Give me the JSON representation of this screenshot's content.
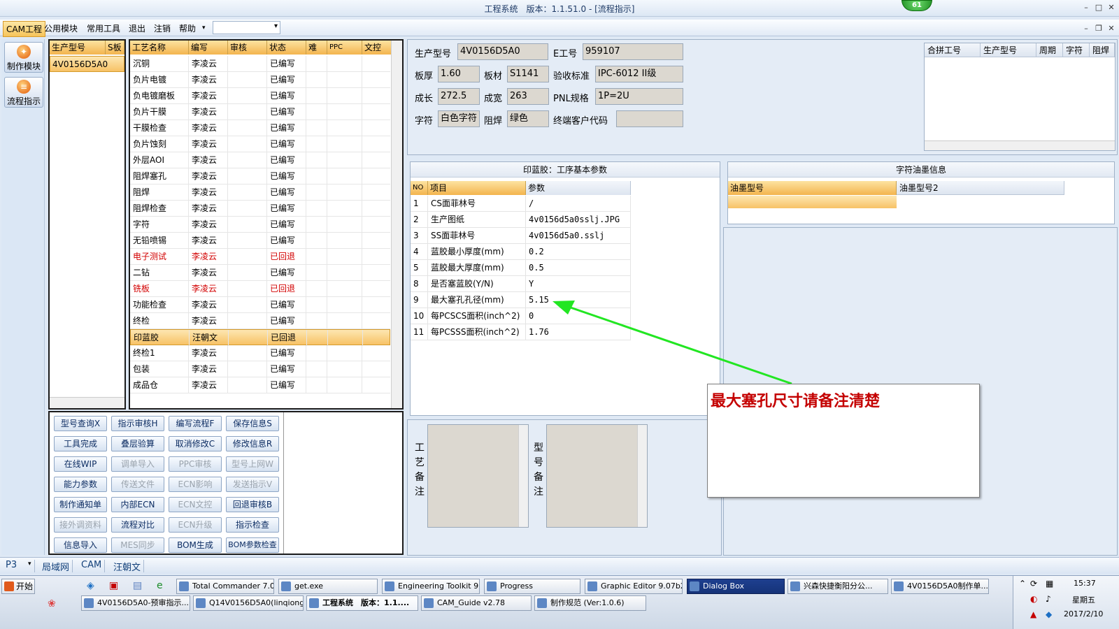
{
  "window": {
    "title": "工程系统　版本：1.1.51.0 - [流程指示]",
    "badge": "61",
    "min": "–",
    "max": "□",
    "close": "✕",
    "child_min": "–",
    "child_max": "❐",
    "child_close": "✕"
  },
  "menu": {
    "cam": "CAM工程",
    "items": [
      "公用模块",
      "常用工具",
      "退出",
      "注销",
      "帮助"
    ],
    "help_arrow": "▾"
  },
  "side": {
    "buttons": [
      "制作模块",
      "流程指示"
    ]
  },
  "model_list": {
    "headers": [
      "生产型号",
      "S板"
    ],
    "items": [
      "4V0156D5A0"
    ]
  },
  "process": {
    "headers": [
      "工艺名称",
      "编写",
      "审核",
      "状态",
      "难",
      "PPC",
      "文控"
    ],
    "rows": [
      {
        "name": "沉铜",
        "writer": "李凌云",
        "status": "已编写",
        "red": false
      },
      {
        "name": "负片电镀",
        "writer": "李凌云",
        "status": "已编写",
        "red": false
      },
      {
        "name": "负电镀磨板",
        "writer": "李凌云",
        "status": "已编写",
        "red": false
      },
      {
        "name": "负片干膜",
        "writer": "李凌云",
        "status": "已编写",
        "red": false
      },
      {
        "name": "干膜检查",
        "writer": "李凌云",
        "status": "已编写",
        "red": false
      },
      {
        "name": "负片蚀刻",
        "writer": "李凌云",
        "status": "已编写",
        "red": false
      },
      {
        "name": "外层AOI",
        "writer": "李凌云",
        "status": "已编写",
        "red": false
      },
      {
        "name": "阻焊塞孔",
        "writer": "李凌云",
        "status": "已编写",
        "red": false
      },
      {
        "name": "阻焊",
        "writer": "李凌云",
        "status": "已编写",
        "red": false
      },
      {
        "name": "阻焊检查",
        "writer": "李凌云",
        "status": "已编写",
        "red": false
      },
      {
        "name": "字符",
        "writer": "李凌云",
        "status": "已编写",
        "red": false
      },
      {
        "name": "无铅喷锡",
        "writer": "李凌云",
        "status": "已编写",
        "red": false
      },
      {
        "name": "电子测试",
        "writer": "李凌云",
        "status": "已回退",
        "red": true
      },
      {
        "name": "二钻",
        "writer": "李凌云",
        "status": "已编写",
        "red": false
      },
      {
        "name": "铣板",
        "writer": "李凌云",
        "status": "已回退",
        "red": true
      },
      {
        "name": "功能检查",
        "writer": "李凌云",
        "status": "已编写",
        "red": false
      },
      {
        "name": "终检",
        "writer": "李凌云",
        "status": "已编写",
        "red": false
      },
      {
        "name": "印蓝胶",
        "writer": "汪朝文",
        "status": "已回退",
        "red": false,
        "selected": true
      },
      {
        "name": "终检1",
        "writer": "李凌云",
        "status": "已编写",
        "red": false
      },
      {
        "name": "包装",
        "writer": "李凌云",
        "status": "已编写",
        "red": false
      },
      {
        "name": "成品仓",
        "writer": "李凌云",
        "status": "已编写",
        "red": false
      }
    ]
  },
  "buttons": [
    [
      {
        "label": "型号查询X",
        "enabled": true
      },
      {
        "label": "指示审核H",
        "enabled": true
      },
      {
        "label": "编写流程F",
        "enabled": true
      },
      {
        "label": "保存信息S",
        "enabled": true
      }
    ],
    [
      {
        "label": "工具完成",
        "enabled": true
      },
      {
        "label": "叠层验算",
        "enabled": true
      },
      {
        "label": "取消修改C",
        "enabled": true
      },
      {
        "label": "修改信息R",
        "enabled": true
      }
    ],
    [
      {
        "label": "在线WIP",
        "enabled": true
      },
      {
        "label": "调单导入",
        "enabled": false
      },
      {
        "label": "PPC审核",
        "enabled": false
      },
      {
        "label": "型号上网W",
        "enabled": false
      }
    ],
    [
      {
        "label": "能力参数",
        "enabled": true
      },
      {
        "label": "传送文件",
        "enabled": false
      },
      {
        "label": "ECN影响",
        "enabled": false
      },
      {
        "label": "发送指示V",
        "enabled": false
      }
    ],
    [
      {
        "label": "制作通知单",
        "enabled": true
      },
      {
        "label": "内部ECN",
        "enabled": true
      },
      {
        "label": "ECN文控",
        "enabled": false
      },
      {
        "label": "回退审核B",
        "enabled": true
      }
    ],
    [
      {
        "label": "接外调资料",
        "enabled": false
      },
      {
        "label": "流程对比",
        "enabled": true
      },
      {
        "label": "ECN升级",
        "enabled": false
      },
      {
        "label": "指示检查",
        "enabled": true
      }
    ],
    [
      {
        "label": "信息导入",
        "enabled": true
      },
      {
        "label": "MES同步",
        "enabled": false
      },
      {
        "label": "BOM生成",
        "enabled": true
      },
      {
        "label": "BOM参数检查",
        "enabled": true
      }
    ]
  ],
  "info": {
    "model_label": "生产型号",
    "model": "4V0156D5A0",
    "e_label": "E工号",
    "e_no": "959107",
    "thick_label": "板厚",
    "thick": "1.60",
    "mat_label": "板材",
    "mat": "S1141",
    "std_label": "验收标准",
    "std": "IPC-6012 II级",
    "len_label": "成长",
    "len": "272.5",
    "wid_label": "成宽",
    "wid": "263",
    "pnl_label": "PNL规格",
    "pnl": "1P=2U",
    "char_label": "字符",
    "char": "白色字符",
    "mask_label": "阻焊",
    "mask": "绿色",
    "cust_label": "终端客户代码",
    "cust": ""
  },
  "combo_grid": {
    "headers": [
      "合拼工号",
      "生产型号",
      "周期",
      "字符",
      "阻焊"
    ]
  },
  "params": {
    "title": "印蓝胶：工序基本参数",
    "headers": [
      "NO",
      "项目",
      "参数"
    ],
    "rows": [
      {
        "no": "1",
        "item": "CS面菲林号",
        "val": "/"
      },
      {
        "no": "2",
        "item": "生产图纸",
        "val": "4v0156d5a0sslj.JPG"
      },
      {
        "no": "3",
        "item": "SS面菲林号",
        "val": "4v0156d5a0.sslj"
      },
      {
        "no": "4",
        "item": "蓝胶最小厚度(mm)",
        "val": "0.2"
      },
      {
        "no": "5",
        "item": "蓝胶最大厚度(mm)",
        "val": "0.5"
      },
      {
        "no": "8",
        "item": "是否塞蓝胶(Y/N)",
        "val": "Y"
      },
      {
        "no": "9",
        "item": "最大塞孔孔径(mm)",
        "val": "5.15"
      },
      {
        "no": "10",
        "item": "每PCSCS面积(inch^2)",
        "val": "0"
      },
      {
        "no": "11",
        "item": "每PCSSS面积(inch^2)",
        "val": "1.76"
      }
    ]
  },
  "ink": {
    "title": "字符油墨信息",
    "headers": [
      "油墨型号",
      "油墨型号2"
    ]
  },
  "notes": {
    "process_label": "工艺备注",
    "model_label": "型号备注"
  },
  "callout": {
    "text": "最大塞孔尺寸请备注清楚"
  },
  "statusbar": {
    "items": [
      "P3",
      "局域网",
      "CAM",
      "汪朝文"
    ]
  },
  "taskbar": {
    "start": "开始",
    "row1": [
      "Total Commander 7.0...",
      "get.exe",
      "Engineering Toolkit 9....",
      "Progress",
      "Graphic Editor 9.07b2...",
      "Dialog Box",
      "兴森快捷衡阳分公...",
      "4V0156D5A0制作单...."
    ],
    "row2": [
      "4V0156D5A0-预审指示....",
      "Q14V0156D5A0(linqiong)...",
      "工程系统　版本：1.1....",
      "CAM_Guide v2.78",
      "制作规范 (Ver:1.0.6)"
    ],
    "time": "15:37",
    "weekday": "星期五",
    "date": "2017/2/10"
  },
  "colors": {
    "arrow": "#22e622",
    "accent": "#f3b44e",
    "red": "#d20000"
  }
}
